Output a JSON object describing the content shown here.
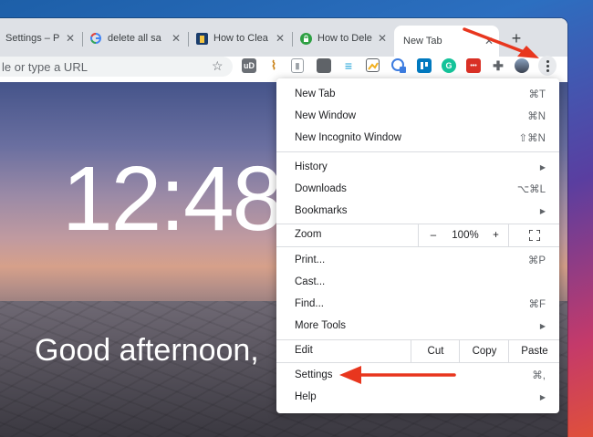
{
  "tabs": [
    {
      "title": "Settings – P",
      "favicon": "puzzle-icon"
    },
    {
      "title": "delete all sa",
      "favicon": "google-icon"
    },
    {
      "title": "How to Clea",
      "favicon": "howtogeek-icon"
    },
    {
      "title": "How to Dele",
      "favicon": "lock-icon"
    },
    {
      "title": "New Tab",
      "favicon": "none"
    }
  ],
  "newtab_symbol": "+",
  "omnibox": {
    "placeholder": "le or type a URL"
  },
  "extensions": [
    {
      "name": "ublock-icon",
      "text": "uD",
      "color": "#5f6368"
    },
    {
      "name": "broom-icon",
      "text": "🧹",
      "color": "#e8a33a"
    },
    {
      "name": "zip-icon",
      "text": "▮",
      "color": "#9aa0a6"
    },
    {
      "name": "window-icon",
      "text": "",
      "color": "#5f6368"
    },
    {
      "name": "filter-icon",
      "text": "≡",
      "color": "#1fa3d8"
    },
    {
      "name": "image-icon",
      "text": "",
      "color": "#f2b01e"
    },
    {
      "name": "badge-4-icon",
      "text": "4",
      "color": "#3c7ce0"
    },
    {
      "name": "trello-icon",
      "text": "",
      "color": "#0079bf"
    },
    {
      "name": "grammarly-icon",
      "text": "G",
      "color": "#15c39a"
    },
    {
      "name": "bar-icon",
      "text": "•••",
      "color": "#d93025"
    },
    {
      "name": "puzzle-icon",
      "text": "",
      "color": "#5f6368"
    }
  ],
  "ntp": {
    "clock": "12:48",
    "greeting": "Good afternoon,"
  },
  "menu": {
    "new_tab": {
      "label": "New Tab",
      "shortcut": "⌘T"
    },
    "new_window": {
      "label": "New Window",
      "shortcut": "⌘N"
    },
    "new_incognito": {
      "label": "New Incognito Window",
      "shortcut": "⇧⌘N"
    },
    "history": {
      "label": "History"
    },
    "downloads": {
      "label": "Downloads",
      "shortcut": "⌥⌘L"
    },
    "bookmarks": {
      "label": "Bookmarks"
    },
    "zoom": {
      "label": "Zoom",
      "minus": "–",
      "value": "100%",
      "plus": "+"
    },
    "print": {
      "label": "Print...",
      "shortcut": "⌘P"
    },
    "cast": {
      "label": "Cast..."
    },
    "find": {
      "label": "Find...",
      "shortcut": "⌘F"
    },
    "more_tools": {
      "label": "More Tools"
    },
    "edit": {
      "label": "Edit",
      "cut": "Cut",
      "copy": "Copy",
      "paste": "Paste"
    },
    "settings": {
      "label": "Settings",
      "shortcut": "⌘,"
    },
    "help": {
      "label": "Help"
    }
  },
  "annotation_color": "#e8361e"
}
